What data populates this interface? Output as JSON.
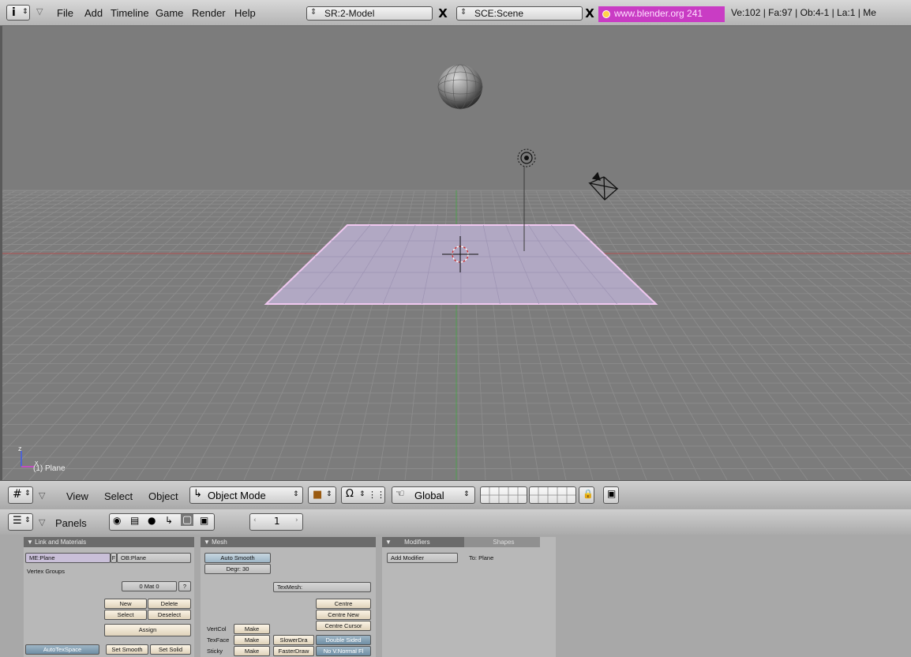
{
  "topbar": {
    "menus": [
      "File",
      "Add",
      "Timeline",
      "Game",
      "Render",
      "Help"
    ],
    "screen_field": "SR:2-Model",
    "scene_field": "SCE:Scene",
    "close_glyph": "X",
    "url": "www.blender.org 241",
    "stats": "Ve:102 | Fa:97 | Ob:4-1 | La:1 | Me"
  },
  "viewport": {
    "object_label": "(1) Plane",
    "axis_z": "z",
    "axis_x": "x"
  },
  "view3d_header": {
    "menus": [
      "View",
      "Select",
      "Object"
    ],
    "mode": "Object Mode",
    "orientation": "Global"
  },
  "buttons_header": {
    "panels_label": "Panels",
    "frame": "1"
  },
  "panels": {
    "link_materials": {
      "title": "Link and Materials",
      "me_field": "ME:Plane",
      "f_label": "F",
      "ob_field": "OB:Plane",
      "vertex_groups": "Vertex Groups",
      "mat_field": "0 Mat 0",
      "mat_q": "?",
      "new": "New",
      "delete": "Delete",
      "select": "Select",
      "deselect": "Deselect",
      "assign": "Assign",
      "autotexspace": "AutoTexSpace",
      "set_smooth": "Set Smooth",
      "set_solid": "Set Solid"
    },
    "mesh": {
      "title": "Mesh",
      "auto_smooth": "Auto Smooth",
      "degr": "Degr: 30",
      "texmesh": "TexMesh:",
      "centre": "Centre",
      "centre_new": "Centre New",
      "centre_cursor": "Centre Cursor",
      "vertcol": "VertCol",
      "texface": "TexFace",
      "sticky": "Sticky",
      "make": "Make",
      "slowerdraw": "SlowerDra",
      "fasterdraw": "FasterDraw",
      "double_sided": "Double Sided",
      "no_vnormal": "No V.Normal Fl"
    },
    "modifiers": {
      "tab_modifiers": "Modifiers",
      "tab_shapes": "Shapes",
      "add_modifier": "Add Modifier",
      "to_plane": "To: Plane"
    }
  },
  "colors": {
    "viewport_bg": "#7c7c7c",
    "grid_line": "#8e8e8e",
    "plane_fill": "#b1a8c3",
    "plane_edge": "#f0c8f0",
    "url_bg": "#c93cc4",
    "x_axis": "#b05050",
    "y_axis": "#4f9f4f"
  }
}
